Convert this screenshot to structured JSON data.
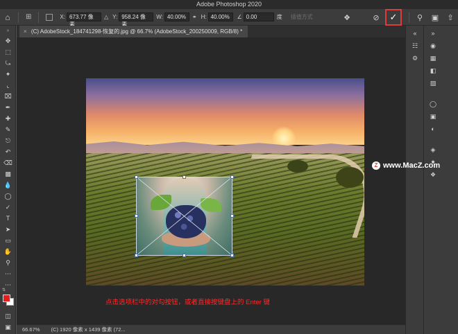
{
  "app": {
    "title": "Adobe Photoshop 2020"
  },
  "options_bar": {
    "x_label": "X:",
    "x_value": "673.77 像素",
    "y_label": "Y:",
    "y_value": "958.24 像素",
    "w_label": "W:",
    "w_value": "40.00%",
    "h_label": "H:",
    "h_value": "40.00%",
    "angle_value": "0.00",
    "angle_unit": "度",
    "interp_label": "插值方式",
    "icons": {
      "home": "home-icon",
      "reference_point": "reference-point-icon",
      "warp": "warp-icon",
      "cancel": "cancel-icon",
      "commit": "commit-checkmark-icon",
      "search": "search-icon",
      "workspace": "workspace-icon",
      "share": "share-icon"
    },
    "accent_color": "#e03a3a"
  },
  "document": {
    "tab_title": "(C) AdobeStock_184741298-恢复的.jpg @ 66.7% (AdobeStock_200250009, RGB/8) *",
    "close_label": "×"
  },
  "annotation": {
    "text": "点击选项栏中的对勾按钮，或者直接按键盘上的 Enter 键",
    "color": "#ff2a2a"
  },
  "watermark": {
    "text": "www.MacZ.com",
    "logo": "Z"
  },
  "status_bar": {
    "zoom": "66.67%",
    "info": "(C) 1920 像素 x 1439 像素 (72..."
  },
  "toolbar": {
    "tools": [
      "move-tool",
      "marquee-tool",
      "lasso-tool",
      "quick-select-tool",
      "crop-tool",
      "frame-tool",
      "eyedropper-tool",
      "healing-tool",
      "brush-tool",
      "stamp-tool",
      "history-brush-tool",
      "eraser-tool",
      "gradient-tool",
      "blur-tool",
      "dodge-tool",
      "pen-tool",
      "type-tool",
      "path-select-tool",
      "rectangle-tool",
      "hand-tool",
      "zoom-tool",
      "more-tools"
    ],
    "foreground_color": "#e02020",
    "background_color": "#ffffff"
  }
}
